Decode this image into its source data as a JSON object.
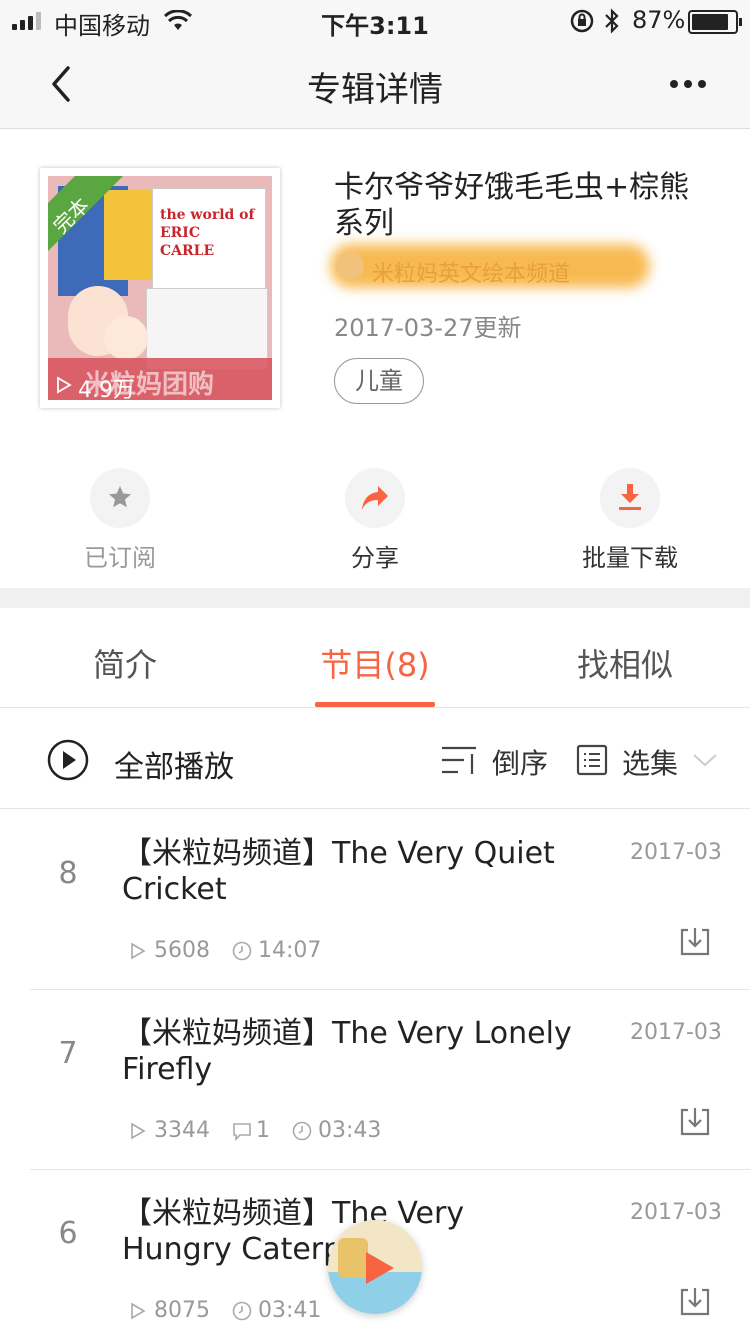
{
  "status_bar": {
    "carrier": "中国移动",
    "time": "下午3:11",
    "battery_pct": "87%"
  },
  "nav": {
    "title": "专辑详情"
  },
  "album": {
    "badge": "完本",
    "play_count": "4.9万",
    "title": "卡尔爷爷好饿毛毛虫+棕熊系列",
    "author": "米粒妈英文绘本频道",
    "updated": "2017-03-27更新",
    "tag": "儿童",
    "cover_caption": "米粒妈团购",
    "cover_book_title": "the world of ERIC CARLE"
  },
  "actions": [
    {
      "label": "已订阅",
      "icon": "star-icon"
    },
    {
      "label": "分享",
      "icon": "share-icon"
    },
    {
      "label": "批量下载",
      "icon": "download-icon"
    }
  ],
  "tabs": [
    {
      "label": "简介"
    },
    {
      "label": "节目(8)"
    },
    {
      "label": "找相似"
    }
  ],
  "toolbar": {
    "play_all": "全部播放",
    "sort": "倒序",
    "select": "选集"
  },
  "episodes": [
    {
      "num": "8",
      "title": "【米粒妈频道】The Very Quiet Cricket",
      "date": "2017-03",
      "plays": "5608",
      "comments": "",
      "duration": "14:07"
    },
    {
      "num": "7",
      "title": "【米粒妈频道】The Very Lonely Firefly",
      "date": "2017-03",
      "plays": "3344",
      "comments": "1",
      "duration": "03:43"
    },
    {
      "num": "6",
      "title": "【米粒妈频道】The Very Hungry Caterpillar",
      "date": "2017-03",
      "plays": "8075",
      "comments": "",
      "duration": "03:41"
    }
  ],
  "colors": {
    "accent": "#f86442",
    "text": "#222222",
    "muted": "#999999"
  }
}
